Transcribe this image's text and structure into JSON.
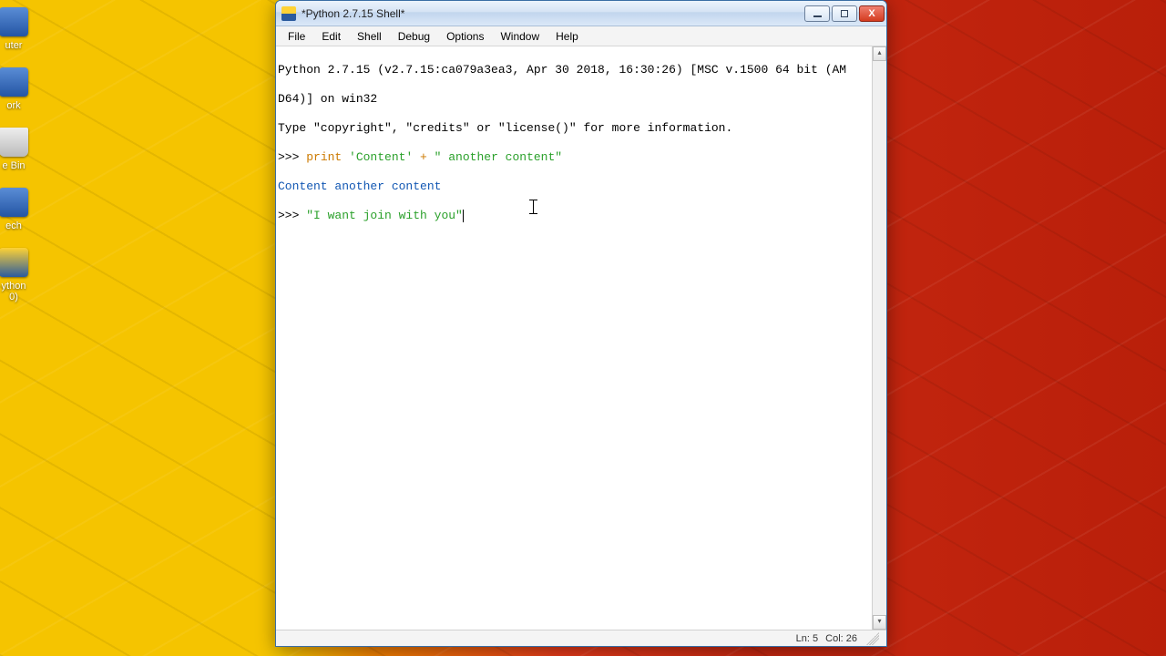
{
  "desktop": {
    "icons": [
      {
        "label": "uter"
      },
      {
        "label": "ork"
      },
      {
        "label": "e Bin"
      },
      {
        "label": "ech"
      },
      {
        "label": "ython\n0)"
      }
    ]
  },
  "window": {
    "title": "*Python 2.7.15 Shell*",
    "menus": [
      "File",
      "Edit",
      "Shell",
      "Debug",
      "Options",
      "Window",
      "Help"
    ]
  },
  "shell": {
    "banner1": "Python 2.7.15 (v2.7.15:ca079a3ea3, Apr 30 2018, 16:30:26) [MSC v.1500 64 bit (AM",
    "banner2": "D64)] on win32",
    "hint": "Type \"copyright\", \"credits\" or \"license()\" for more information.",
    "prompt": ">>> ",
    "cmd1_kw": "print ",
    "cmd1_str1": "'Content'",
    "cmd1_op": " + ",
    "cmd1_str2": "\" another content\"",
    "out1": "Content another content",
    "cmd2_str": "\"I want join with you\""
  },
  "status": {
    "line": "Ln: 5",
    "col": "Col: 26"
  }
}
